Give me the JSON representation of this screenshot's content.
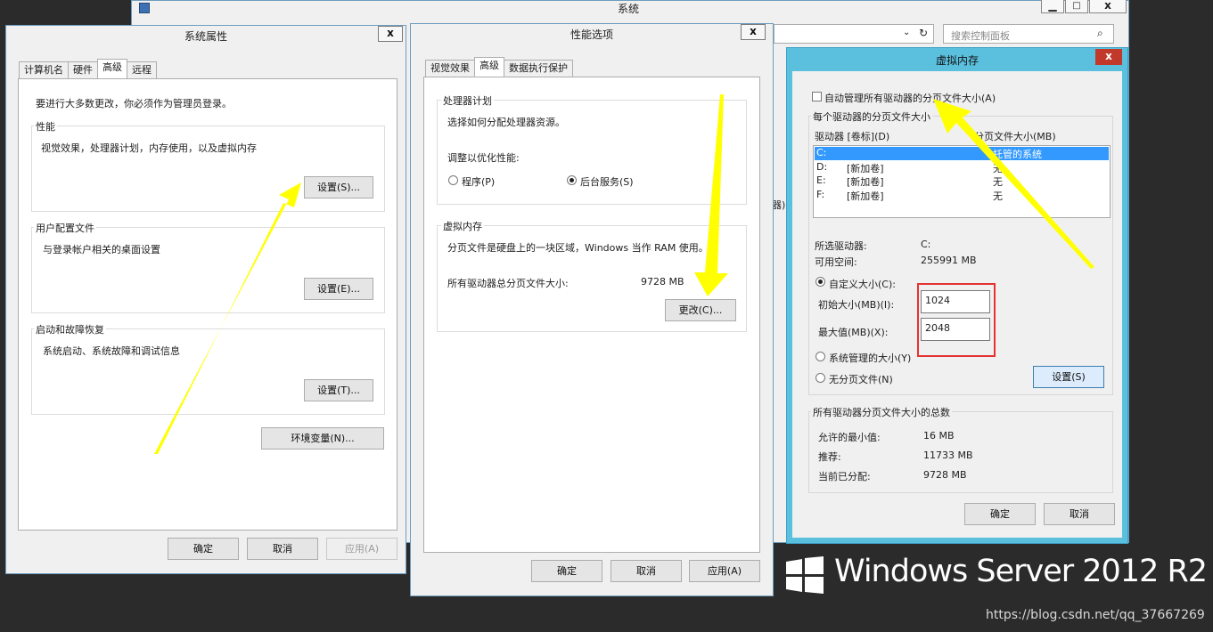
{
  "system_window": {
    "title": "系统",
    "search_placeholder": "搜索控制面板",
    "bg_label_fragment": "器)"
  },
  "sys_props": {
    "title": "系统属性",
    "close": "x",
    "tabs": [
      "计算机名",
      "硬件",
      "高级",
      "远程"
    ],
    "admin_note": "要进行大多数更改，你必须作为管理员登录。",
    "perf": {
      "legend": "性能",
      "desc": "视觉效果，处理器计划，内存使用，以及虚拟内存",
      "button": "设置(S)..."
    },
    "profile": {
      "legend": "用户配置文件",
      "desc": "与登录帐户相关的桌面设置",
      "button": "设置(E)..."
    },
    "startup": {
      "legend": "启动和故障恢复",
      "desc": "系统启动、系统故障和调试信息",
      "button": "设置(T)..."
    },
    "env_button": "环境变量(N)...",
    "ok": "确定",
    "cancel": "取消",
    "apply": "应用(A)"
  },
  "perf_options": {
    "title": "性能选项",
    "close": "x",
    "tabs": [
      "视觉效果",
      "高级",
      "数据执行保护"
    ],
    "proc": {
      "legend": "处理器计划",
      "desc": "选择如何分配处理器资源。",
      "adjust": "调整以优化性能:",
      "opt_programs": "程序(P)",
      "opt_services": "后台服务(S)"
    },
    "vm": {
      "legend": "虚拟内存",
      "desc": "分页文件是硬盘上的一块区域，Windows 当作 RAM 使用。",
      "total_label": "所有驱动器总分页文件大小:",
      "total_value": "9728 MB",
      "change_button": "更改(C)..."
    },
    "ok": "确定",
    "cancel": "取消",
    "apply": "应用(A)"
  },
  "virtual_memory": {
    "title": "虚拟内存",
    "close": "x",
    "auto_manage": "自动管理所有驱动器的分页文件大小(A)",
    "group_label": "每个驱动器的分页文件大小",
    "col_drive": "驱动器 [卷标](D)",
    "col_size": "分页文件大小(MB)",
    "drives": [
      {
        "drive": "C:",
        "label": "",
        "size": "托管的系统"
      },
      {
        "drive": "D:",
        "label": "[新加卷]",
        "size": "无"
      },
      {
        "drive": "E:",
        "label": "[新加卷]",
        "size": "无"
      },
      {
        "drive": "F:",
        "label": "[新加卷]",
        "size": "无"
      }
    ],
    "selected_drive_label": "所选驱动器:",
    "selected_drive_value": "C:",
    "free_label": "可用空间:",
    "free_value": "255991 MB",
    "custom_size": "自定义大小(C):",
    "initial_label": "初始大小(MB)(I):",
    "initial_value": "1024",
    "max_label": "最大值(MB)(X):",
    "max_value": "2048",
    "system_managed": "系统管理的大小(Y)",
    "no_paging": "无分页文件(N)",
    "set_button": "设置(S)",
    "totals_label": "所有驱动器分页文件大小的总数",
    "min_label": "允许的最小值:",
    "min_value": "16 MB",
    "rec_label": "推荐:",
    "rec_value": "11733 MB",
    "cur_label": "当前已分配:",
    "cur_value": "9728 MB",
    "ok": "确定",
    "cancel": "取消"
  },
  "branding": {
    "text": "Windows Server 2012 R2"
  },
  "watermark": "https://blog.csdn.net/qq_37667269",
  "colors": {
    "arrow": "#ffff00",
    "highlight_box": "#e53333",
    "vm_titlebar": "#5bc0de",
    "vm_close": "#c0392b"
  }
}
